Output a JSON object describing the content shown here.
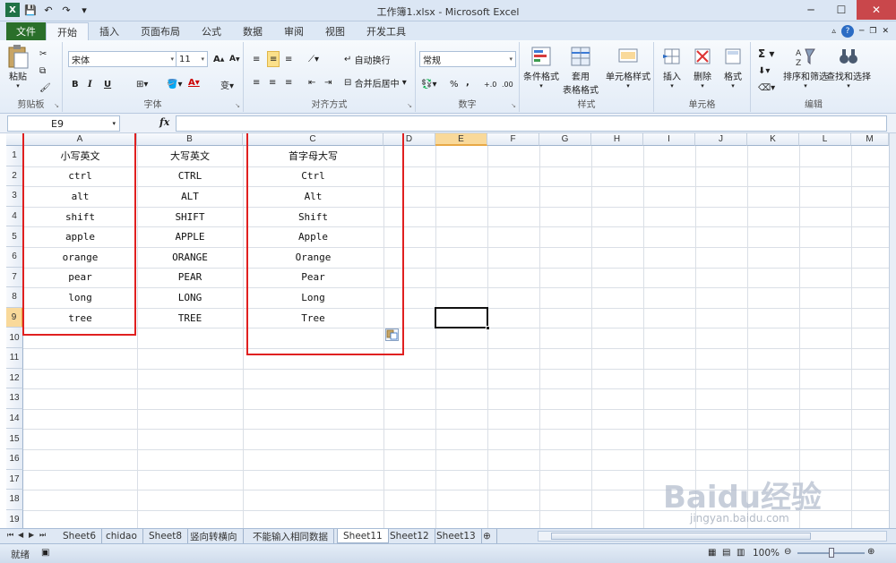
{
  "window": {
    "title": "工作簿1.xlsx - Microsoft Excel",
    "controls": [
      "minimize",
      "maximize",
      "close"
    ]
  },
  "ribbon_tabs": {
    "file": "文件",
    "tabs": [
      "开始",
      "插入",
      "页面布局",
      "公式",
      "数据",
      "审阅",
      "视图",
      "开发工具"
    ],
    "active": "开始"
  },
  "ribbon": {
    "clipboard": {
      "label": "剪贴板",
      "paste": "粘贴"
    },
    "font": {
      "label": "字体",
      "name": "宋体",
      "size": "11",
      "bold": "B",
      "italic": "I",
      "underline": "U"
    },
    "alignment": {
      "label": "对齐方式",
      "wrap": "自动换行",
      "merge": "合并后居中"
    },
    "number": {
      "label": "数字",
      "format": "常规",
      "percent": "%",
      "comma": ","
    },
    "styles": {
      "label": "样式",
      "conditional": "条件格式",
      "table_line1": "套用",
      "table_line2": "表格格式",
      "cell_styles": "单元格样式"
    },
    "cells": {
      "label": "单元格",
      "insert": "插入",
      "delete": "删除",
      "format": "格式"
    },
    "editing": {
      "label": "编辑",
      "sigma": "Σ",
      "sort": "排序和筛选",
      "find": "查找和选择"
    }
  },
  "formula_bar": {
    "name_box": "E9",
    "fx": "fx",
    "value": ""
  },
  "grid": {
    "columns": [
      "A",
      "B",
      "C",
      "D",
      "E",
      "F",
      "G",
      "H",
      "I",
      "J",
      "K",
      "L",
      "M"
    ],
    "rows": [
      "1",
      "2",
      "3",
      "4",
      "5",
      "6",
      "7",
      "8",
      "9",
      "10",
      "11",
      "12",
      "13",
      "14",
      "15",
      "16",
      "17",
      "18",
      "19"
    ],
    "selected_cell": "E9",
    "col_a": [
      "小写英文",
      "ctrl",
      "alt",
      "shift",
      "apple",
      "orange",
      "pear",
      "long",
      "tree"
    ],
    "col_b": [
      "大写英文",
      "CTRL",
      "ALT",
      "SHIFT",
      "APPLE",
      "ORANGE",
      "PEAR",
      "LONG",
      "TREE"
    ],
    "col_c": [
      "首字母大写",
      "Ctrl",
      "Alt",
      "Shift",
      "Apple",
      "Orange",
      "Pear",
      "Long",
      "Tree"
    ],
    "highlight_color": "#e02020"
  },
  "sheet_tabs": {
    "tabs": [
      "Sheet6",
      "chidao",
      "Sheet8",
      "竖向转横向",
      "不能输入相同数据",
      "Sheet11",
      "Sheet12",
      "Sheet13"
    ],
    "active": "Sheet11"
  },
  "status_bar": {
    "ready": "就绪",
    "zoom": "100%",
    "zoom_level": 1.0
  },
  "watermark": {
    "main": "Baidu经验",
    "sub": "jingyan.baidu.com"
  }
}
